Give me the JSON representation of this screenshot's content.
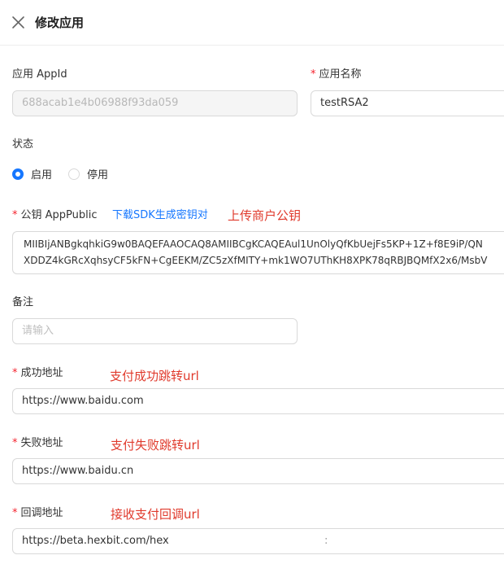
{
  "header": {
    "title": "修改应用"
  },
  "form": {
    "appid": {
      "label": "应用 AppId",
      "value": "688acab1e4b06988f93da059"
    },
    "app_name": {
      "required_mark": "*",
      "label": "应用名称",
      "value": "testRSA2"
    },
    "status": {
      "label": "状态",
      "options": [
        {
          "label": "启用",
          "selected": true
        },
        {
          "label": "停用",
          "selected": false
        }
      ]
    },
    "public_key": {
      "required_mark": "*",
      "label": "公钥 AppPublic",
      "download_link": "下载SDK生成密钥对",
      "annotation": "上传商户公钥",
      "lines": [
        "MIIBIjANBgkqhkiG9w0BAQEFAAOCAQ8AMIIBCgKCAQEAul1UnOlyQfKbUejFs5KP+1Z+f8E9iP/QN",
        "XDDZ4kGRcXqhsyCF5kFN+CgEEKM/ZC5zXfMITY+mk1WO7UThKH8XPK78qRBJBQMfX2x6/MsbV"
      ]
    },
    "remark": {
      "label": "备注",
      "placeholder": "请输入"
    },
    "success_url": {
      "required_mark": "*",
      "label": "成功地址",
      "annotation": "支付成功跳转url",
      "value": "https://www.baidu.com"
    },
    "fail_url": {
      "required_mark": "*",
      "label": "失败地址",
      "annotation": "支付失败跳转url",
      "value": "https://www.baidu.cn"
    },
    "callback_url": {
      "required_mark": "*",
      "label": "回调地址",
      "annotation": "接收支付回调url",
      "value": "https://beta.hexbit.com/hex",
      "trailing_fragment": ":"
    }
  },
  "colors": {
    "primary": "#1677ff",
    "required": "#f5222d",
    "annotation": "#e03a2c"
  },
  "icons": {
    "close": "close-icon"
  }
}
